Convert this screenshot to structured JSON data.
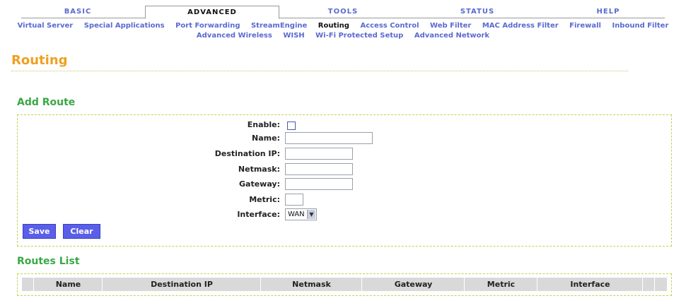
{
  "tabs": [
    "BASIC",
    "ADVANCED",
    "TOOLS",
    "STATUS",
    "HELP"
  ],
  "subnav_row1": [
    "Virtual Server",
    "Special Applications",
    "Port Forwarding",
    "StreamEngine",
    "Routing",
    "Access Control",
    "Web Filter",
    "MAC Address Filter",
    "Firewall",
    "Inbound Filter"
  ],
  "subnav_row2": [
    "Advanced Wireless",
    "WISH",
    "Wi-Fi Protected Setup",
    "Advanced Network"
  ],
  "page_title": "Routing",
  "add_route": {
    "title": "Add Route",
    "enable_label": "Enable:",
    "name_label": "Name:",
    "destination_label": "Destination IP:",
    "netmask_label": "Netmask:",
    "gateway_label": "Gateway:",
    "metric_label": "Metric:",
    "interface_label": "Interface:",
    "interface_value": "WAN",
    "save_label": "Save",
    "clear_label": "Clear"
  },
  "routes_list": {
    "title": "Routes List",
    "columns": [
      "Name",
      "Destination IP",
      "Netmask",
      "Gateway",
      "Metric",
      "Interface"
    ]
  }
}
